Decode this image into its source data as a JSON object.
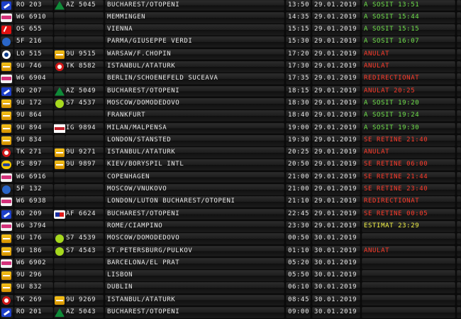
{
  "flights": [
    {
      "logo": "lg-blue",
      "logo_name": "tarom-logo",
      "flight": "RO 203",
      "logo2": "lg-az",
      "logo2_name": "alitalia-logo",
      "flight2": "AZ 5045",
      "dest": "BUCHAREST/OTOPENI",
      "time": "13:50",
      "date": "29.01.2019",
      "status": "A SOSIT 13:51",
      "status_color": "green"
    },
    {
      "logo": "lg-pink",
      "logo_name": "wizzair-logo",
      "flight": "W6 6910",
      "logo2": "",
      "logo2_name": "",
      "flight2": "",
      "dest": "MEMMINGEN",
      "time": "14:35",
      "date": "29.01.2019",
      "status": "A SOSIT 15:44",
      "status_color": "green"
    },
    {
      "logo": "lg-red",
      "logo_name": "austrian-logo",
      "flight": "OS 655",
      "logo2": "",
      "logo2_name": "",
      "flight2": "",
      "dest": "VIENNA",
      "time": "15:15",
      "date": "29.01.2019",
      "status": "A SOSIT 15:15",
      "status_color": "green"
    },
    {
      "logo": "lg-sf",
      "logo_name": "airline-logo",
      "flight": "5F 216",
      "logo2": "",
      "logo2_name": "",
      "flight2": "",
      "dest": "PARMA/GIUSEPPE VERDI",
      "time": "15:30",
      "date": "29.01.2019",
      "status": "A SOSIT 16:07",
      "status_color": "green"
    },
    {
      "logo": "lg-lo",
      "logo_name": "lot-logo",
      "flight": "LO 515",
      "logo2": "lg-yellow",
      "logo2_name": "blueair-logo",
      "flight2": "9U 9515",
      "dest": "WARSAW/F.CHOPIN",
      "time": "17:20",
      "date": "29.01.2019",
      "status": "ANULAT",
      "status_color": "red"
    },
    {
      "logo": "lg-yellow",
      "logo_name": "airmoldova-logo",
      "flight": "9U 746",
      "logo2": "lg-tk",
      "logo2_name": "turkish-logo",
      "flight2": "TK 8582",
      "dest": "ISTANBUL/ATATURK",
      "time": "17:30",
      "date": "29.01.2019",
      "status": "ANULAT",
      "status_color": "red"
    },
    {
      "logo": "lg-pink",
      "logo_name": "wizzair-logo",
      "flight": "W6 6904",
      "logo2": "",
      "logo2_name": "",
      "flight2": "",
      "dest": "BERLIN/SCHOENEFELD  SUCEAVA",
      "time": "17:35",
      "date": "29.01.2019",
      "status": "REDIRECTIONAT",
      "status_color": "red"
    },
    {
      "logo": "lg-blue",
      "logo_name": "tarom-logo",
      "flight": "RO 207",
      "logo2": "lg-az",
      "logo2_name": "alitalia-logo",
      "flight2": "AZ 5049",
      "dest": "BUCHAREST/OTOPENI",
      "time": "18:15",
      "date": "29.01.2019",
      "status": "ANULAT 20:25",
      "status_color": "red"
    },
    {
      "logo": "lg-yellow",
      "logo_name": "airmoldova-logo",
      "flight": "9U 172",
      "logo2": "lg-s7",
      "logo2_name": "s7-logo",
      "flight2": "S7 4537",
      "dest": "MOSCOW/DOMODEDOVO",
      "time": "18:30",
      "date": "29.01.2019",
      "status": "A SOSIT 19:20",
      "status_color": "green"
    },
    {
      "logo": "lg-yellow",
      "logo_name": "airmoldova-logo",
      "flight": "9U 864",
      "logo2": "",
      "logo2_name": "",
      "flight2": "",
      "dest": "FRANKFURT",
      "time": "18:40",
      "date": "29.01.2019",
      "status": "A SOSIT 19:24",
      "status_color": "green"
    },
    {
      "logo": "lg-yellow",
      "logo_name": "airmoldova-logo",
      "flight": "9U 894",
      "logo2": "lg-ig",
      "logo2_name": "airitaly-logo",
      "flight2": "IG 9894",
      "dest": "MILAN/MALPENSA",
      "time": "19:00",
      "date": "29.01.2019",
      "status": "A SOSIT 19:30",
      "status_color": "green"
    },
    {
      "logo": "lg-yellow",
      "logo_name": "airmoldova-logo",
      "flight": "9U 834",
      "logo2": "",
      "logo2_name": "",
      "flight2": "",
      "dest": "LONDON/STANSTED",
      "time": "19:30",
      "date": "29.01.2019",
      "status": "SE RETINE 21:40",
      "status_color": "red"
    },
    {
      "logo": "lg-tk",
      "logo_name": "turkish-logo",
      "flight": "TK 271",
      "logo2": "lg-yellow",
      "logo2_name": "airmoldova-logo",
      "flight2": "9U 9271",
      "dest": "ISTANBUL/ATATURK",
      "time": "20:25",
      "date": "29.01.2019",
      "status": "ANULAT",
      "status_color": "red"
    },
    {
      "logo": "lg-ps",
      "logo_name": "uia-logo",
      "flight": "PS 897",
      "logo2": "lg-yellow",
      "logo2_name": "airmoldova-logo",
      "flight2": "9U 9897",
      "dest": "KIEV/BORYSPIL INTL",
      "time": "20:50",
      "date": "29.01.2019",
      "status": "SE RETINE 06:00",
      "status_color": "red"
    },
    {
      "logo": "lg-pink",
      "logo_name": "wizzair-logo",
      "flight": "W6 6916",
      "logo2": "",
      "logo2_name": "",
      "flight2": "",
      "dest": "COPENHAGEN",
      "time": "21:00",
      "date": "29.01.2019",
      "status": "SE RETINE 21:44",
      "status_color": "red"
    },
    {
      "logo": "lg-sf",
      "logo_name": "airline-logo",
      "flight": "5F 132",
      "logo2": "",
      "logo2_name": "",
      "flight2": "",
      "dest": "MOSCOW/VNUKOVO",
      "time": "21:00",
      "date": "29.01.2019",
      "status": "SE RETINE 23:40",
      "status_color": "red"
    },
    {
      "logo": "lg-pink",
      "logo_name": "wizzair-logo",
      "flight": "W6 6938",
      "logo2": "",
      "logo2_name": "",
      "flight2": "",
      "dest": "LONDON/LUTON          BUCHAREST/OTOPENI",
      "time": "21:10",
      "date": "29.01.2019",
      "status": "REDIRECTIONAT",
      "status_color": "red"
    },
    {
      "logo": "lg-blue",
      "logo_name": "tarom-logo",
      "flight": "RO 209",
      "logo2": "lg-af",
      "logo2_name": "airfrance-logo",
      "flight2": "AF 6624",
      "dest": "BUCHAREST/OTOPENI",
      "time": "22:45",
      "date": "29.01.2019",
      "status": "SE RETINE 00:05",
      "status_color": "red"
    },
    {
      "logo": "lg-pink",
      "logo_name": "wizzair-logo",
      "flight": "W6 3794",
      "logo2": "",
      "logo2_name": "",
      "flight2": "",
      "dest": "ROME/CIAMPINO",
      "time": "23:30",
      "date": "29.01.2019",
      "status": "ESTIMAT 23:29",
      "status_color": "yellow"
    },
    {
      "logo": "lg-yellow",
      "logo_name": "airmoldova-logo",
      "flight": "9U 176",
      "logo2": "lg-s7",
      "logo2_name": "s7-logo",
      "flight2": "S7 4539",
      "dest": "MOSCOW/DOMODEDOVO",
      "time": "00:50",
      "date": "30.01.2019",
      "status": "",
      "status_color": "green"
    },
    {
      "logo": "lg-yellow",
      "logo_name": "airmoldova-logo",
      "flight": "9U 186",
      "logo2": "lg-s7",
      "logo2_name": "s7-logo",
      "flight2": "S7 4543",
      "dest": "ST.PETERSBURG/PULKOV",
      "time": "01:10",
      "date": "30.01.2019",
      "status": "ANULAT",
      "status_color": "red"
    },
    {
      "logo": "lg-pink",
      "logo_name": "wizzair-logo",
      "flight": "W6 6902",
      "logo2": "",
      "logo2_name": "",
      "flight2": "",
      "dest": "BARCELONA/EL PRAT",
      "time": "05:20",
      "date": "30.01.2019",
      "status": "",
      "status_color": "green"
    },
    {
      "logo": "lg-yellow",
      "logo_name": "airmoldova-logo",
      "flight": "9U 296",
      "logo2": "",
      "logo2_name": "",
      "flight2": "",
      "dest": "LISBON",
      "time": "05:50",
      "date": "30.01.2019",
      "status": "",
      "status_color": "green"
    },
    {
      "logo": "lg-yellow",
      "logo_name": "airmoldova-logo",
      "flight": "9U 832",
      "logo2": "",
      "logo2_name": "",
      "flight2": "",
      "dest": "DUBLIN",
      "time": "06:10",
      "date": "30.01.2019",
      "status": "",
      "status_color": "green"
    },
    {
      "logo": "lg-tk",
      "logo_name": "turkish-logo",
      "flight": "TK 269",
      "logo2": "lg-yellow",
      "logo2_name": "airmoldova-logo",
      "flight2": "9U 9269",
      "dest": "ISTANBUL/ATATURK",
      "time": "08:45",
      "date": "30.01.2019",
      "status": "",
      "status_color": "green"
    },
    {
      "logo": "lg-blue",
      "logo_name": "tarom-logo",
      "flight": "RO 201",
      "logo2": "lg-az",
      "logo2_name": "alitalia-logo",
      "flight2": "AZ 5043",
      "dest": "BUCHAREST/OTOPENI",
      "time": "09:00",
      "date": "30.01.2019",
      "status": "",
      "status_color": "green"
    }
  ]
}
